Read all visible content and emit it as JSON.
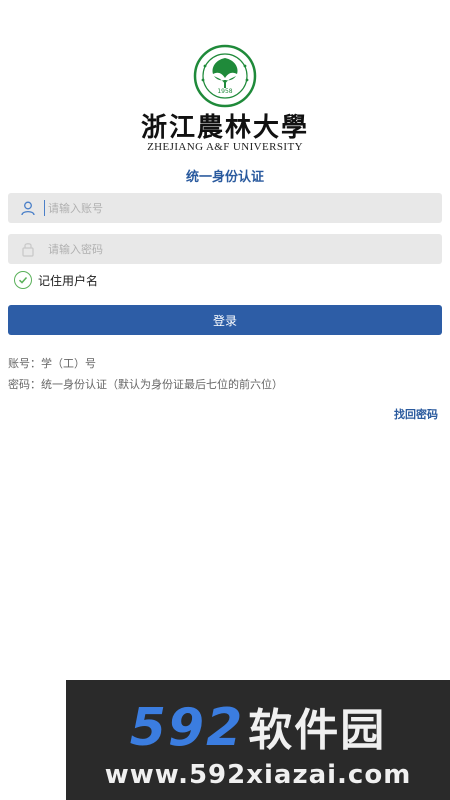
{
  "header": {
    "university_cn": "浙江農林大學",
    "university_en": "ZHEJIANG A&F UNIVERSITY",
    "seal_year": "1958",
    "subtitle": "统一身份认证"
  },
  "form": {
    "account_placeholder": "请输入账号",
    "password_placeholder": "请输入密码",
    "remember_label": "记住用户名",
    "login_label": "登录"
  },
  "hints": {
    "account_hint": "账号：学（工）号",
    "password_hint": "密码：统一身份认证（默认为身份证最后七位的前六位）"
  },
  "links": {
    "forgot_password": "找回密码"
  },
  "watermark": {
    "number": "592",
    "name": "软件园",
    "url": "www.592xiazai.com"
  },
  "colors": {
    "primary": "#2d5da6",
    "link": "#2a5a9e",
    "check": "#5ab15a",
    "seal_green": "#1f8a3a"
  },
  "icons": {
    "account": "user-icon",
    "password": "lock-icon",
    "remember": "check-circle-icon"
  }
}
